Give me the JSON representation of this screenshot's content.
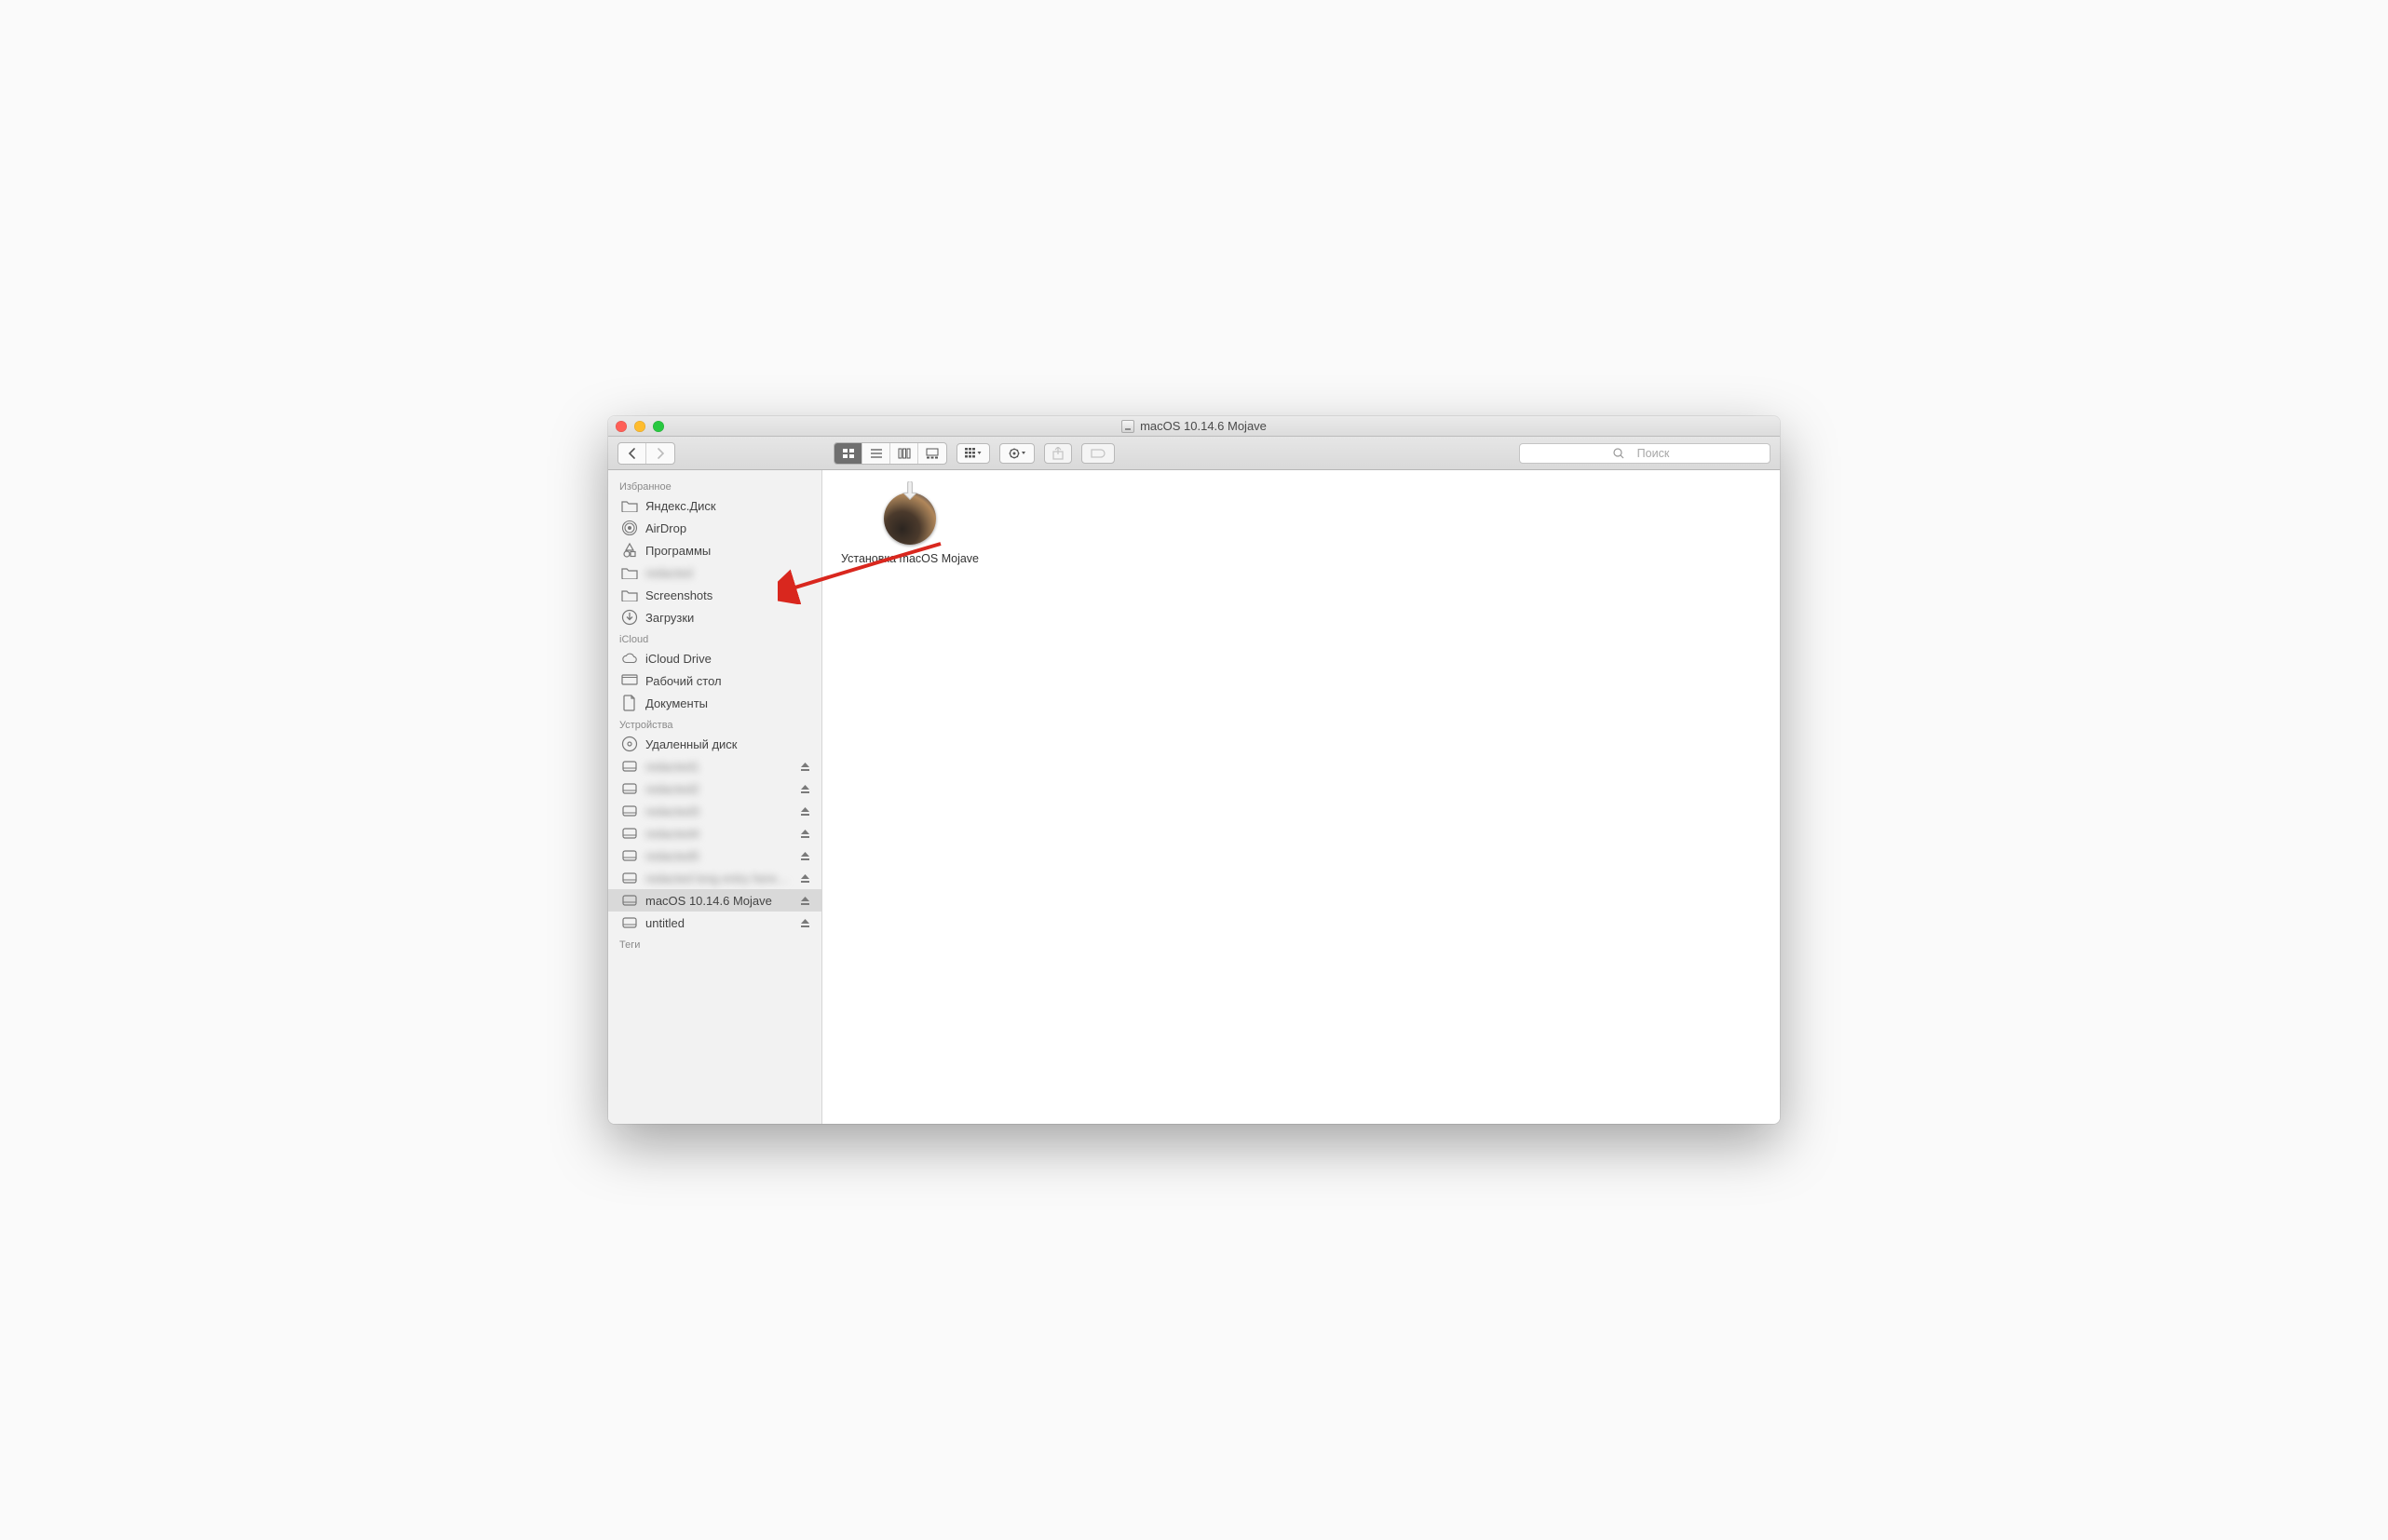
{
  "titlebar": {
    "title": "macOS 10.14.6 Mojave"
  },
  "toolbar": {
    "search_placeholder": "Поиск"
  },
  "sidebar": {
    "favorites": {
      "header": "Избранное",
      "items": [
        {
          "label": "Яндекс.Диск",
          "icon": "folder"
        },
        {
          "label": "AirDrop",
          "icon": "airdrop"
        },
        {
          "label": "Программы",
          "icon": "applications"
        },
        {
          "label": "redacted",
          "icon": "folder",
          "blur": true
        },
        {
          "label": "Screenshots",
          "icon": "folder"
        },
        {
          "label": "Загрузки",
          "icon": "downloads"
        }
      ]
    },
    "icloud": {
      "header": "iCloud",
      "items": [
        {
          "label": "iCloud Drive",
          "icon": "cloud"
        },
        {
          "label": "Рабочий стол",
          "icon": "desktop"
        },
        {
          "label": "Документы",
          "icon": "document"
        }
      ]
    },
    "devices": {
      "header": "Устройства",
      "items": [
        {
          "label": "Удаленный диск",
          "icon": "optical",
          "eject": false
        },
        {
          "label": "redacted1",
          "icon": "disk",
          "eject": true,
          "blur": true
        },
        {
          "label": "redacted2",
          "icon": "disk",
          "eject": true,
          "blur": true
        },
        {
          "label": "redacted3",
          "icon": "disk",
          "eject": true,
          "blur": true
        },
        {
          "label": "redacted4",
          "icon": "disk",
          "eject": true,
          "blur": true
        },
        {
          "label": "redacted5",
          "icon": "disk",
          "eject": true,
          "blur": true
        },
        {
          "label": "redacted long entry here…",
          "icon": "disk",
          "eject": true,
          "blur": true
        },
        {
          "label": "macOS 10.14.6 Mojave",
          "icon": "disk",
          "eject": true,
          "selected": true
        },
        {
          "label": "untitled",
          "icon": "disk",
          "eject": true
        }
      ]
    },
    "tags": {
      "header": "Теги"
    }
  },
  "main": {
    "items": [
      {
        "label": "Установка macOS Mojave"
      }
    ]
  }
}
